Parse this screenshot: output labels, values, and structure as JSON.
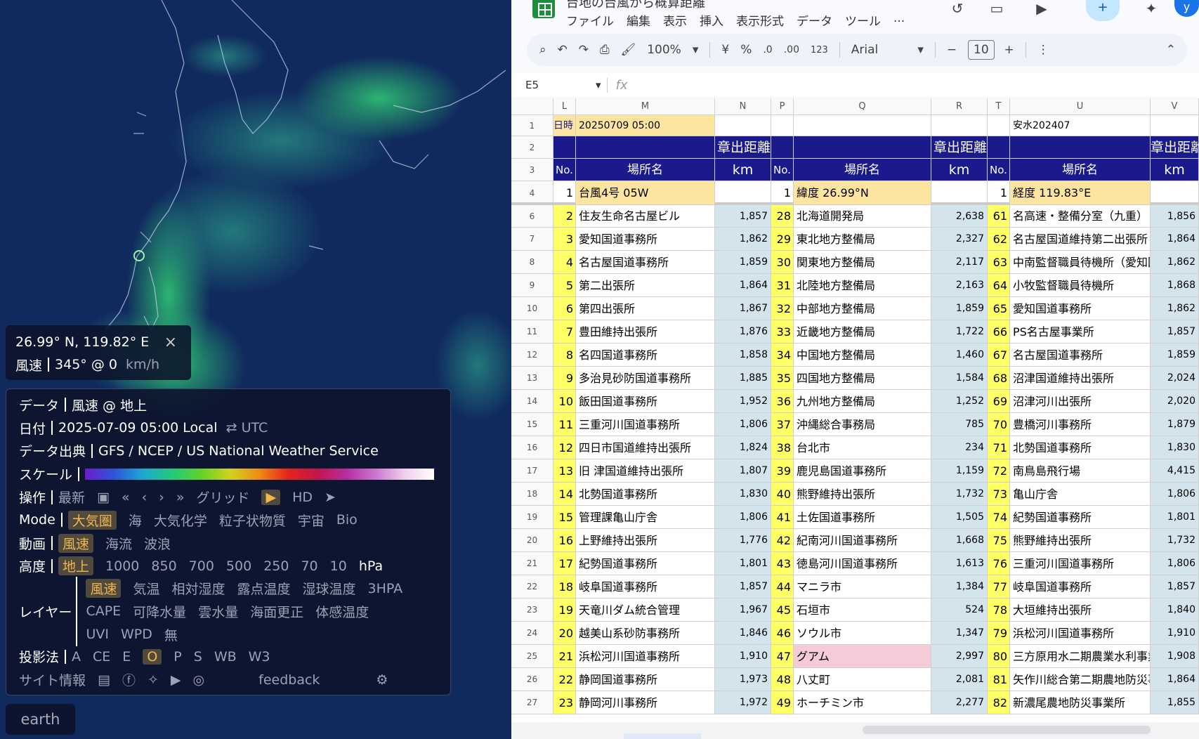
{
  "map": {
    "coord_text": "26.99° N, 119.82° E",
    "close_glyph": "×",
    "wind_label": "風速",
    "wind_value": "345° @ 0",
    "wind_unit": "km/h",
    "app_name": "earth",
    "panel": {
      "data_label": "データ",
      "data_value": "風速 @ 地上",
      "date_label": "日付",
      "date_value": "2025-07-09 05:00 Local",
      "swap_glyph": "⇄",
      "date_alt": "UTC",
      "source_label": "データ出典",
      "source_value": "GFS / NCEP / US National Weather Service",
      "scale_label": "スケール",
      "ops_label": "操作",
      "ops_latest": "最新",
      "ops_grid": "グリッド",
      "ops_hd": "HD",
      "mode_label": "Mode",
      "modes": [
        "大気圏",
        "海",
        "大気化学",
        "粒子状物質",
        "宇宙",
        "Bio"
      ],
      "anim_label": "動画",
      "anims": [
        "風速",
        "海流",
        "波浪"
      ],
      "height_label": "高度",
      "heights": [
        "地上",
        "1000",
        "850",
        "700",
        "500",
        "250",
        "70",
        "10"
      ],
      "height_unit": "hPa",
      "layer_label": "レイヤー",
      "layers_row1": [
        "風速",
        "気温",
        "相対湿度",
        "露点温度",
        "湿球温度",
        "3HPA"
      ],
      "layers_row2": [
        "CAPE",
        "可降水量",
        "雲水量",
        "海面更正",
        "体感温度"
      ],
      "layers_row3": [
        "UVI",
        "WPD",
        "無"
      ],
      "proj_label": "投影法",
      "projs": [
        "A",
        "CE",
        "E",
        "O",
        "P",
        "S",
        "WB",
        "W3"
      ],
      "site_label": "サイト情報",
      "feedback": "feedback"
    }
  },
  "sheet": {
    "doc_title": "台地の台風から概算距離",
    "menus": [
      "ファイル",
      "編集",
      "表示",
      "挿入",
      "表示形式",
      "データ",
      "ツール",
      "..."
    ],
    "toolbar": {
      "zoom": "100%",
      "currency": "¥",
      "percent": "%",
      "dec_less": ".0",
      "dec_more": ".00",
      "fmt123": "123",
      "font": "Arial",
      "font_size": "10",
      "minus": "−",
      "plus": "+"
    },
    "cell_ref": "E5",
    "fx": "fx",
    "col_headers": [
      "L",
      "M",
      "N",
      "P",
      "Q",
      "R",
      "T",
      "U",
      "V"
    ],
    "header_rows": {
      "r1": {
        "date_label": "日時",
        "date_value": "20250709  05:00",
        "u": "安水202407"
      },
      "r2_title": "章出距離",
      "r3": {
        "no": "No.",
        "place": "場所名",
        "km": "km"
      },
      "r4": [
        {
          "no": "1",
          "place": "台風4号 05W",
          "km": ""
        },
        {
          "no": "1",
          "place": "緯度 26.99°N",
          "km": ""
        },
        {
          "no": "1",
          "place": "経度 119.83°E",
          "km": ""
        }
      ]
    },
    "row_numbers": [
      "1",
      "2",
      "3",
      "4",
      "6",
      "7",
      "8",
      "9",
      "10",
      "11",
      "12",
      "13",
      "14",
      "15",
      "16",
      "17",
      "18",
      "19",
      "20",
      "21",
      "22",
      "23",
      "24",
      "25",
      "26",
      "27"
    ],
    "rows": [
      [
        [
          "2",
          "住友生命名古屋ビル",
          "1,857"
        ],
        [
          "28",
          "北海道開発局",
          "2,638"
        ],
        [
          "61",
          "名高速・整備分室（九重）",
          "1,856"
        ]
      ],
      [
        [
          "3",
          "愛知国道事務所",
          "1,862"
        ],
        [
          "29",
          "東北地方整備局",
          "2,327"
        ],
        [
          "62",
          "名古屋国道維持第二出張所",
          "1,864"
        ]
      ],
      [
        [
          "4",
          "名古屋国道事務所",
          "1,859"
        ],
        [
          "30",
          "関東地方整備局",
          "2,117"
        ],
        [
          "63",
          "中南監督職員待機所（愛知国",
          "1,862"
        ]
      ],
      [
        [
          "5",
          "第二出張所",
          "1,864"
        ],
        [
          "31",
          "北陸地方整備局",
          "2,163"
        ],
        [
          "64",
          "小牧監督職員待機所",
          "1,868"
        ]
      ],
      [
        [
          "6",
          "第四出張所",
          "1,867"
        ],
        [
          "32",
          "中部地方整備局",
          "1,859"
        ],
        [
          "65",
          "愛知国道事務所",
          "1,862"
        ]
      ],
      [
        [
          "7",
          "豊田維持出張所",
          "1,876"
        ],
        [
          "33",
          "近畿地方整備局",
          "1,722"
        ],
        [
          "66",
          "PS名古屋事業所",
          "1,857"
        ]
      ],
      [
        [
          "8",
          "名四国道事務所",
          "1,858"
        ],
        [
          "34",
          "中国地方整備局",
          "1,460"
        ],
        [
          "67",
          "名古屋国道事務所",
          "1,859"
        ]
      ],
      [
        [
          "9",
          "多治見砂防国道事務所",
          "1,885"
        ],
        [
          "35",
          "四国地方整備局",
          "1,584"
        ],
        [
          "68",
          "沼津国道維持出張所",
          "2,024"
        ]
      ],
      [
        [
          "10",
          "飯田国道事務所",
          "1,952"
        ],
        [
          "36",
          "九州地方整備局",
          "1,252"
        ],
        [
          "69",
          "沼津河川出張所",
          "2,020"
        ]
      ],
      [
        [
          "11",
          "三重河川国道事務所",
          "1,806"
        ],
        [
          "37",
          "沖縄総合事務局",
          "785"
        ],
        [
          "70",
          "豊橋河川事務所",
          "1,879"
        ]
      ],
      [
        [
          "12",
          "四日市国道維持出張所",
          "1,824"
        ],
        [
          "38",
          "台北市",
          "234"
        ],
        [
          "71",
          "北勢国道事務所",
          "1,830"
        ]
      ],
      [
        [
          "13",
          "旧 津国道維持出張所",
          "1,807"
        ],
        [
          "39",
          "鹿児島国道事務所",
          "1,159"
        ],
        [
          "72",
          "南鳥島飛行場",
          "4,415"
        ]
      ],
      [
        [
          "14",
          "北勢国道事務所",
          "1,830"
        ],
        [
          "40",
          "熊野維持出張所",
          "1,732"
        ],
        [
          "73",
          "亀山庁舎",
          "1,806"
        ]
      ],
      [
        [
          "15",
          "管理課亀山庁舎",
          "1,806"
        ],
        [
          "41",
          "土佐国道事務所",
          "1,505"
        ],
        [
          "74",
          "紀勢国道事務所",
          "1,801"
        ]
      ],
      [
        [
          "16",
          "上野維持出張所",
          "1,776"
        ],
        [
          "42",
          "紀南河川国道事務所",
          "1,668"
        ],
        [
          "75",
          "熊野維持出張所",
          "1,732"
        ]
      ],
      [
        [
          "17",
          "紀勢国道事務所",
          "1,801"
        ],
        [
          "43",
          "徳島河川国道事務所",
          "1,613"
        ],
        [
          "76",
          "三重河川国道事務所",
          "1,806"
        ]
      ],
      [
        [
          "18",
          "岐阜国道事務所",
          "1,857"
        ],
        [
          "44",
          "マニラ市",
          "1,384"
        ],
        [
          "77",
          "岐阜国道事務所",
          "1,857"
        ]
      ],
      [
        [
          "19",
          "天竜川ダム統合管理",
          "1,967"
        ],
        [
          "45",
          "石垣市",
          "524"
        ],
        [
          "78",
          "大垣維持出張所",
          "1,840"
        ]
      ],
      [
        [
          "20",
          "越美山系砂防事務所",
          "1,846"
        ],
        [
          "46",
          "ソウル市",
          "1,347"
        ],
        [
          "79",
          "浜松河川国道事務所",
          "1,910"
        ]
      ],
      [
        [
          "21",
          "浜松河川国道事務所",
          "1,910"
        ],
        [
          "47",
          "グアム",
          "2,997"
        ],
        [
          "80",
          "三方原用水二期農業水利事業",
          "1,908"
        ]
      ],
      [
        [
          "22",
          "静岡国道事務所",
          "1,973"
        ],
        [
          "48",
          "八丈町",
          "2,081"
        ],
        [
          "81",
          "矢作川総合第二期農地防災事",
          "1,864"
        ]
      ],
      [
        [
          "23",
          "静岡河川事務所",
          "1,972"
        ],
        [
          "49",
          "ホーチミン市",
          "2,277"
        ],
        [
          "82",
          "新濃尾農地防災事業所",
          "1,855"
        ]
      ]
    ],
    "colors": {
      "no_fill": "#ffff66",
      "header_navy": "#1a1a8c",
      "km_fill": "#d4e4ec",
      "row4_fill": "#fde5a0",
      "guam_fill": "#f4cbd6"
    }
  }
}
